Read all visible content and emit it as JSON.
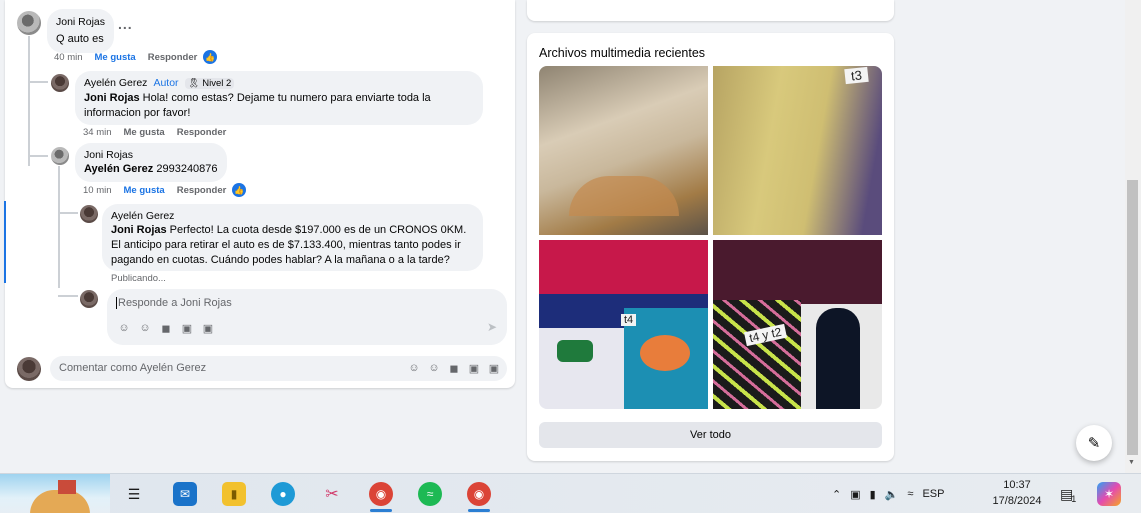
{
  "thread": {
    "comment1": {
      "author": "Joni Rojas",
      "text": "Q auto es",
      "time": "40 min",
      "like": "Me gusta",
      "reply": "Responder",
      "more": "..."
    },
    "reply1": {
      "author": "Ayelén Gerez",
      "role": "Autor",
      "level": "Nivel 2",
      "mention": "Joni Rojas",
      "text": " Hola! como estas? Dejame tu numero para enviarte toda la informacion por favor!",
      "time": "34 min",
      "like": "Me gusta",
      "reply": "Responder"
    },
    "reply2": {
      "author": "Joni Rojas",
      "mention": "Ayelén Gerez",
      "text": " 2993240876",
      "time": "10 min",
      "like": "Me gusta",
      "reply": "Responder"
    },
    "reply3": {
      "author": "Ayelén Gerez",
      "mention": "Joni Rojas",
      "text": " Perfecto! La cuota desde $197.000 es de un CRONOS 0KM. El anticipo para retirar el auto es de $7.133.400, mientras tanto podes ir pagando en cuotas. Cuándo podes hablar? A la mañana o a la tarde?",
      "status": "Publicando..."
    },
    "reply_input": {
      "placeholder": "Responde a Joni Rojas"
    },
    "comment_input": {
      "placeholder": "Comentar como Ayelén Gerez"
    }
  },
  "media": {
    "title": "Archivos multimedia recientes",
    "labels": [
      "t3",
      "t4",
      "t4 y t2"
    ],
    "see_all": "Ver todo"
  },
  "taskbar": {
    "tray": {
      "language": "ESP",
      "time": "10:37",
      "date": "17/8/2024",
      "notification_count": "1"
    }
  },
  "colors": {
    "accent": "#1b74e4",
    "bubble": "#f0f2f5",
    "muted": "#65676b"
  }
}
